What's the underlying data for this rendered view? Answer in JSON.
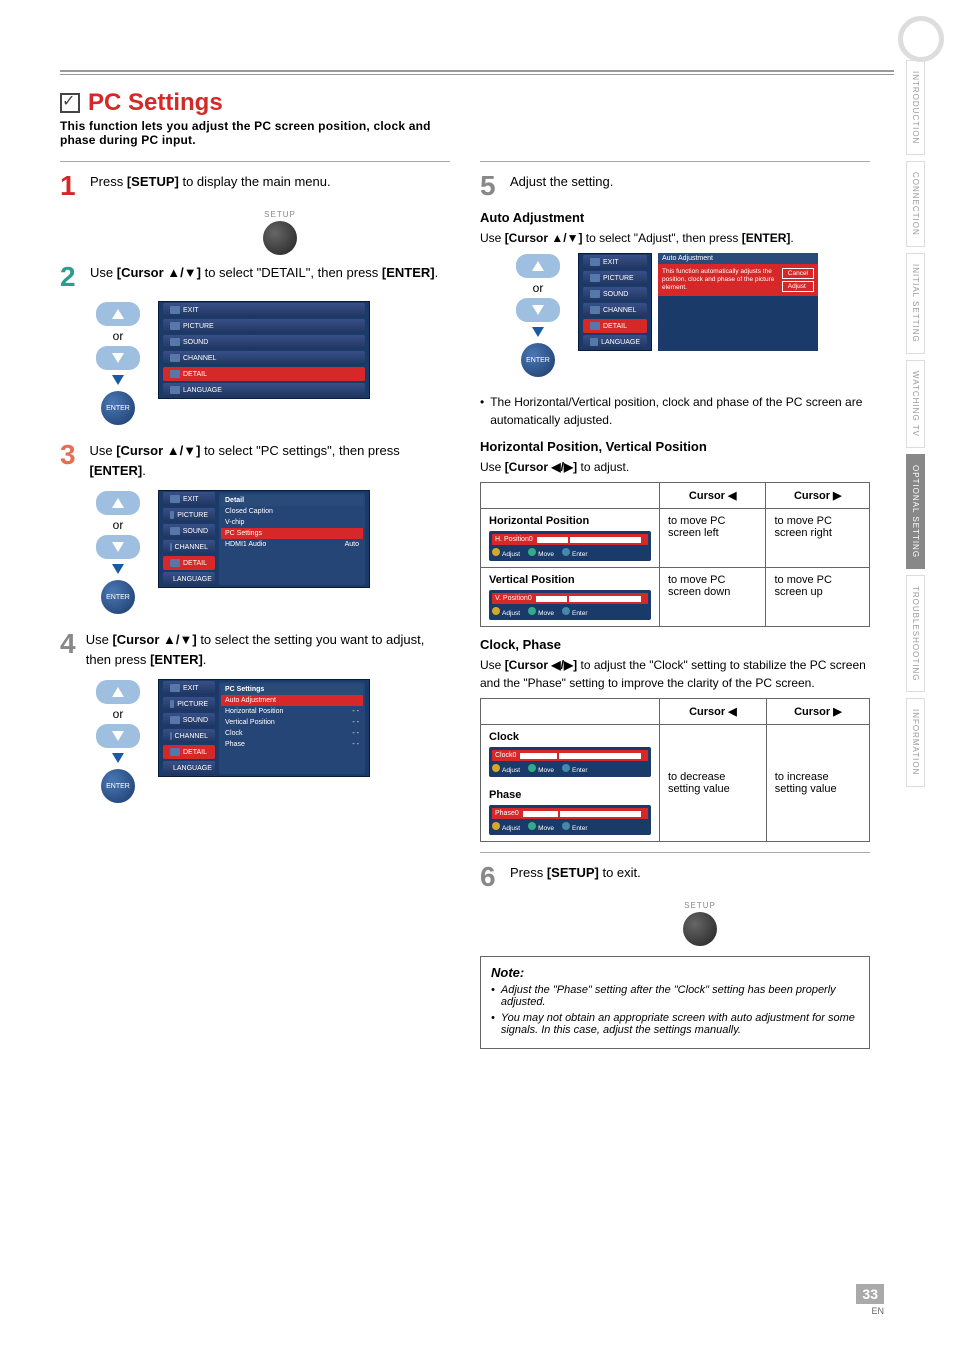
{
  "side": {
    "tabs": [
      "INTRODUCTION",
      "CONNECTION",
      "INITIAL SETTING",
      "WATCHING TV",
      "OPTIONAL SETTING",
      "TROUBLESHOOTING",
      "INFORMATION"
    ]
  },
  "header": {
    "title": "PC Settings",
    "sub": "This function lets you adjust the PC screen position, clock and phase during PC input."
  },
  "labels": {
    "setup": "SETUP",
    "or": "or",
    "enter": "ENTER"
  },
  "steps": {
    "s1": {
      "pre": "Press ",
      "btn": "[SETUP]",
      "post": " to display the main menu."
    },
    "s2": {
      "pre": "Use ",
      "btn": "[Cursor ▲/▼]",
      "mid": " to select \"DETAIL\", then press ",
      "btn2": "[ENTER]",
      "post": "."
    },
    "s3": {
      "pre": "Use ",
      "btn": "[Cursor ▲/▼]",
      "mid": " to select \"PC settings\", then press ",
      "btn2": "[ENTER]",
      "post": "."
    },
    "s4": {
      "pre": "Use ",
      "btn": "[Cursor ▲/▼]",
      "mid": " to select the setting you want to adjust, then press ",
      "btn2": "[ENTER]",
      "post": "."
    },
    "s5": {
      "text": "Adjust the setting."
    },
    "s6": {
      "pre": "Press ",
      "btn": "[SETUP]",
      "post": " to exit."
    }
  },
  "osd_sidebar": [
    "EXIT",
    "PICTURE",
    "SOUND",
    "CHANNEL",
    "DETAIL",
    "LANGUAGE"
  ],
  "osd_detail": {
    "head": "Detail",
    "rows": [
      {
        "l": "Closed Caption"
      },
      {
        "l": "V-chip"
      },
      {
        "l": "PC Settings"
      },
      {
        "l": "HDMI1 Audio",
        "r": "Auto"
      }
    ]
  },
  "osd_pcset": {
    "head": "PC Settings",
    "rows": [
      {
        "l": "Auto Adjustment",
        "sel": true
      },
      {
        "l": "Horizontal Position",
        "r": "- -"
      },
      {
        "l": "Vertical Position",
        "r": "- -"
      },
      {
        "l": "Clock",
        "r": "- -"
      },
      {
        "l": "Phase",
        "r": "- -"
      }
    ]
  },
  "auto_adj": {
    "head": "Auto Adjustment",
    "pre": "Use ",
    "btn": "[Cursor ▲/▼]",
    "mid": " to select \"Adjust\", then press ",
    "btn2": "[ENTER]",
    "post": ".",
    "osd_title": "Auto Adjustment",
    "msg": "This function automatically adjusts the position, clock and phase of the picture element.",
    "b1": "Cancel",
    "b2": "Adjust",
    "bullet": "The Horizontal/Vertical position, clock and phase of the PC screen are automatically adjusted."
  },
  "hv": {
    "head": "Horizontal Position, Vertical Position",
    "pre": "Use ",
    "btn": "[Cursor ◀/▶]",
    "post": " to adjust.",
    "th_left": "Cursor ◀",
    "th_right": "Cursor ▶",
    "r1": {
      "label": "Horizontal Position",
      "tag": "H. Position",
      "adj": "Adjust",
      "mv": "Move",
      "en": "Enter",
      "cl": "to move PC screen left",
      "cr": "to move PC screen right"
    },
    "r2": {
      "label": "Vertical Position",
      "tag": "V. Position",
      "adj": "Adjust",
      "mv": "Move",
      "en": "Enter",
      "cl": "to move PC screen down",
      "cr": "to move PC screen up"
    }
  },
  "cp": {
    "head": "Clock, Phase",
    "para_pre": "Use ",
    "btn": "[Cursor ◀/▶]",
    "para_post": " to adjust the \"Clock\" setting to stabilize the PC screen and the \"Phase\" setting to improve the clarity of the PC screen.",
    "th_left": "Cursor ◀",
    "th_right": "Cursor ▶",
    "r1": {
      "label": "Clock",
      "tag": "Clock",
      "adj": "Adjust",
      "mv": "Move",
      "en": "Enter"
    },
    "r2": {
      "label": "Phase",
      "tag": "Phase",
      "adj": "Adjust",
      "mv": "Move",
      "en": "Enter"
    },
    "cl": "to decrease setting value",
    "cr": "to increase setting value"
  },
  "note": {
    "head": "Note:",
    "n1": "Adjust the \"Phase\" setting after the \"Clock\" setting has been properly adjusted.",
    "n2": "You may not obtain an appropriate screen with auto adjustment for some signals. In this case, adjust the settings manually."
  },
  "foot": {
    "page": "33",
    "en": "EN"
  }
}
